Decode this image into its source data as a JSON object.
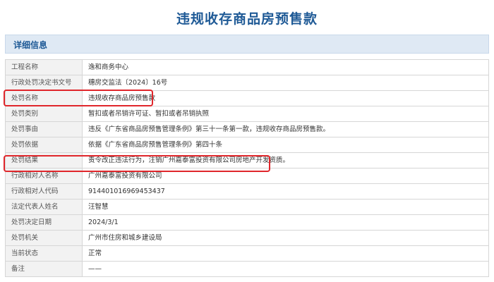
{
  "page_title": "违规收存商品房预售款",
  "section_title": "详细信息",
  "rows": [
    {
      "label": "工程名称",
      "value": "逸和商务中心"
    },
    {
      "label": "行政处罚决定书文号",
      "value": "穗房交监法〔2024〕16号"
    },
    {
      "label": "处罚名称",
      "value": "违规收存商品房预售款"
    },
    {
      "label": "处罚类别",
      "value": "暂扣或者吊销许可证、暂扣或者吊销执照"
    },
    {
      "label": "处罚事由",
      "value": "违反《广东省商品房预售管理条例》第三十一条第一款，违规收存商品房预售款。"
    },
    {
      "label": "处罚依据",
      "value": "依据《广东省商品房预售管理条例》第四十条"
    },
    {
      "label": "处罚结果",
      "value": "责令改正违法行为，注销广州嘉泰富投资有限公司房地产开发资质。"
    },
    {
      "label": "行政相对人名称",
      "value": "广州嘉泰富投资有限公司"
    },
    {
      "label": "行政相对人代码",
      "value": "914401016969453437"
    },
    {
      "label": "法定代表人姓名",
      "value": "汪智慧"
    },
    {
      "label": "处罚决定日期",
      "value": "2024/3/1"
    },
    {
      "label": "处罚机关",
      "value": "广州市住房和城乡建设局"
    },
    {
      "label": "当前状态",
      "value": "正常"
    },
    {
      "label": "备注",
      "value": "——"
    }
  ],
  "colors": {
    "title": "#1f5a96",
    "highlight": "#e0262b",
    "header_bg": "#dfe9f4"
  }
}
